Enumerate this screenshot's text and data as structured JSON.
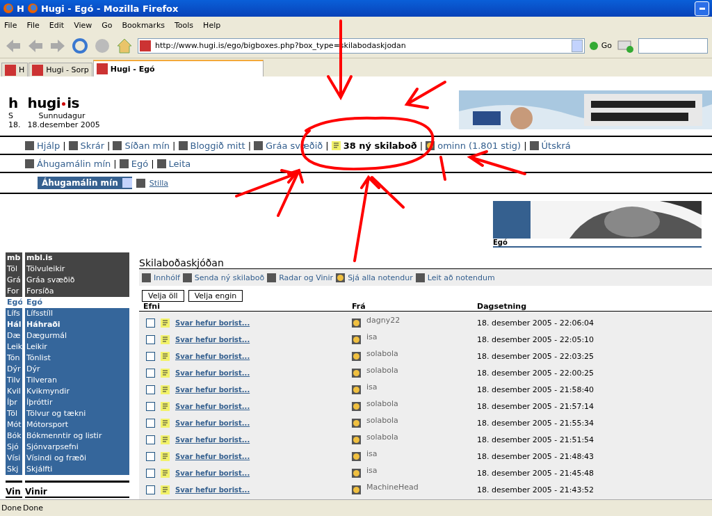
{
  "window": {
    "title": "Hugi - Egó - Mozilla Firefox",
    "ghost_title": "H"
  },
  "menu": [
    "File",
    "File",
    "Edit",
    "View",
    "Go",
    "Bookmarks",
    "Tools",
    "Help"
  ],
  "address": {
    "value": "http://www.hugi.is/ego/bigboxes.php?box_type=skilabodaskjodan",
    "go": "Go"
  },
  "tabs": [
    {
      "label": "H",
      "selected": false
    },
    {
      "label": "Hugi - Sorp",
      "selected": false
    },
    {
      "label": "Hugi - Egó",
      "selected": true
    }
  ],
  "header": {
    "ghost_logo": "h",
    "logo": "hugi",
    "logo_tail": "is",
    "ghost_day": "S",
    "day": "Sunnudagur",
    "ghost_date": "18.",
    "date": "18.desember 2005"
  },
  "nav_main": [
    {
      "label": "Hjálp",
      "kind": "link"
    },
    {
      "label": "Skrár",
      "kind": "link"
    },
    {
      "label": "Síðan mín",
      "kind": "link"
    },
    {
      "label": "Bloggið mitt",
      "kind": "link"
    },
    {
      "label": "Gráa svæðið",
      "kind": "link"
    },
    {
      "label": "38 ný skilaboð",
      "kind": "messages"
    },
    {
      "label": "ominn",
      "kind": "user",
      "extra": "(1.801 ",
      "extra_link": "stig",
      "extra_end": ")"
    },
    {
      "label": "Útskrá",
      "kind": "link"
    }
  ],
  "nav_separator": "|",
  "nav_second": [
    "Áhugamálin mín",
    "Egó",
    "Leita"
  ],
  "nav_third": {
    "select": "Áhugamálin mín",
    "link": "Stilla"
  },
  "sidebar": [
    {
      "label": "mbl.is",
      "kind": "dark",
      "bold": true,
      "ghost": "mb"
    },
    {
      "label": "Tölvuleikir",
      "kind": "dark",
      "bold": false,
      "ghost": "Töl"
    },
    {
      "label": "Gráa svæðið",
      "kind": "dark",
      "bold": false,
      "ghost": "Grá"
    },
    {
      "label": "Forsíða",
      "kind": "dark",
      "bold": false,
      "ghost": "For"
    },
    {
      "label": "Egó",
      "kind": "heading",
      "bold": true,
      "ghost": "Egó"
    },
    {
      "label": "Lífsstíll",
      "kind": "blue",
      "bold": false,
      "ghost": "Lífs"
    },
    {
      "label": "Háhraði",
      "kind": "blue",
      "bold": true,
      "ghost": "Hál"
    },
    {
      "label": "Dægurmál",
      "kind": "blue",
      "bold": false,
      "ghost": "Dæ"
    },
    {
      "label": "Leikir",
      "kind": "blue",
      "bold": false,
      "ghost": "Leik"
    },
    {
      "label": "Tónlist",
      "kind": "blue",
      "bold": false,
      "ghost": "Tón"
    },
    {
      "label": "Dýr",
      "kind": "blue",
      "bold": false,
      "ghost": "Dýr"
    },
    {
      "label": "Tilveran",
      "kind": "blue",
      "bold": false,
      "ghost": "Tilv"
    },
    {
      "label": "Kvikmyndir",
      "kind": "blue",
      "bold": false,
      "ghost": "Kvil"
    },
    {
      "label": "Íþróttir",
      "kind": "blue",
      "bold": false,
      "ghost": "Íþr"
    },
    {
      "label": "Tölvur og tækni",
      "kind": "blue",
      "bold": false,
      "ghost": "Töl"
    },
    {
      "label": "Mótorsport",
      "kind": "blue",
      "bold": false,
      "ghost": "Mót"
    },
    {
      "label": "Bókmenntir og listir",
      "kind": "blue",
      "bold": false,
      "ghost": "Bók"
    },
    {
      "label": "Sjónvarpsefni",
      "kind": "blue",
      "bold": false,
      "ghost": "Sjó"
    },
    {
      "label": "Vísindi og fræði",
      "kind": "blue",
      "bold": false,
      "ghost": "Vísi"
    },
    {
      "label": "Skjálfti",
      "kind": "blue",
      "bold": false,
      "ghost": "Skj"
    }
  ],
  "sidebar_footer": {
    "label": "Vinir",
    "ghost": "Vin"
  },
  "feature": {
    "caption": "Egó"
  },
  "inbox": {
    "title": "Skilaboðaskjóðan",
    "toolbar": [
      "Innhólf",
      "Senda ný skilaboð",
      "Radar og Vinir",
      "Sjá alla notendur",
      "Leit að notendum"
    ],
    "buttons": [
      "Velja öll",
      "Velja engin"
    ],
    "columns": [
      "Efni",
      "Frá",
      "Dagsetning"
    ],
    "rows": [
      {
        "subject": "Svar hefur borist...",
        "from": "dagny22",
        "date": "18. desember 2005 - 22:06:04",
        "checked": false
      },
      {
        "subject": "Svar hefur borist...",
        "from": "isa",
        "date": "18. desember 2005 - 22:05:10",
        "checked": false
      },
      {
        "subject": "Svar hefur borist...",
        "from": "solabola",
        "date": "18. desember 2005 - 22:03:25",
        "checked": false
      },
      {
        "subject": "Svar hefur borist...",
        "from": "solabola",
        "date": "18. desember 2005 - 22:00:25",
        "checked": false
      },
      {
        "subject": "Svar hefur borist...",
        "from": "isa",
        "date": "18. desember 2005 - 21:58:40",
        "checked": false
      },
      {
        "subject": "Svar hefur borist...",
        "from": "solabola",
        "date": "18. desember 2005 - 21:57:14",
        "checked": false
      },
      {
        "subject": "Svar hefur borist...",
        "from": "solabola",
        "date": "18. desember 2005 - 21:55:34",
        "checked": false
      },
      {
        "subject": "Svar hefur borist...",
        "from": "solabola",
        "date": "18. desember 2005 - 21:51:54",
        "checked": false
      },
      {
        "subject": "Svar hefur borist...",
        "from": "isa",
        "date": "18. desember 2005 - 21:48:43",
        "checked": false
      },
      {
        "subject": "Svar hefur borist...",
        "from": "isa",
        "date": "18. desember 2005 - 21:45:48",
        "checked": false
      },
      {
        "subject": "Svar hefur borist...",
        "from": "MachineHead",
        "date": "18. desember 2005 - 21:43:52",
        "checked": false
      }
    ]
  },
  "status_bar": {
    "ghost": "Done",
    "text": "Done"
  }
}
